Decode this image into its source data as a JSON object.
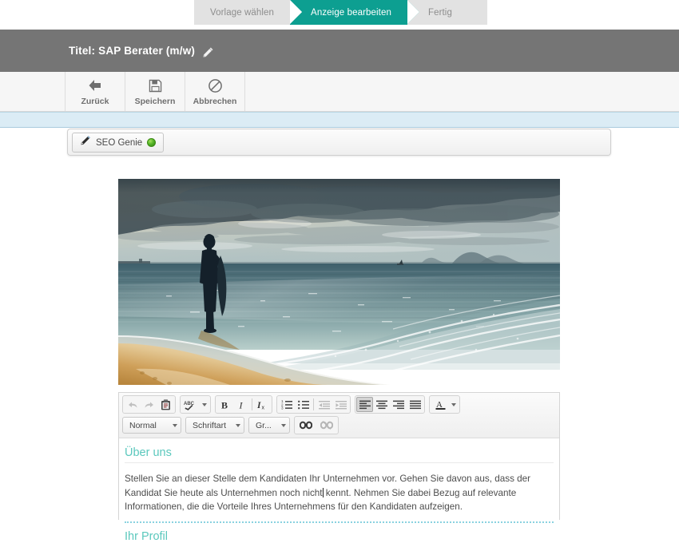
{
  "wizard": {
    "steps": [
      {
        "label": "Vorlage wählen",
        "active": false
      },
      {
        "label": "Anzeige bearbeiten",
        "active": true
      },
      {
        "label": "Fertig",
        "active": false
      }
    ],
    "active_color": "#0d9f91",
    "inactive_color": "#e2e2e2"
  },
  "titlebar": {
    "label": "Titel:",
    "value": "SAP Berater (m/w)",
    "full": "Titel: SAP Berater (m/w)",
    "edit_icon": "pencil-icon",
    "background": "#757575"
  },
  "actions": [
    {
      "label": "Zurück",
      "icon": "arrow-left-icon"
    },
    {
      "label": "Speichern",
      "icon": "floppy-disk-icon"
    },
    {
      "label": "Abbrechen",
      "icon": "prohibition-icon"
    }
  ],
  "seo": {
    "label": "SEO Genie",
    "icon": "magic-pen-icon",
    "status_icon": "green-status-dot",
    "status_color": "#56b528"
  },
  "hero": {
    "alt": "Silhouette einer Person am Strand bei Sonnenuntergang mit Wolken und Meer"
  },
  "editor": {
    "toolbar_row1": [
      {
        "name": "undo-icon",
        "title": "Rückgängig",
        "state": "disabled"
      },
      {
        "name": "redo-icon",
        "title": "Wiederholen",
        "state": "disabled"
      },
      {
        "name": "paste-clipboard-icon",
        "title": "Einfügen",
        "state": "normal"
      },
      {
        "name": "spellcheck-icon",
        "title": "Rechtschreibprüfung",
        "state": "dropdown"
      },
      {
        "name": "bold-icon",
        "title": "Fett",
        "label": "B",
        "state": "normal"
      },
      {
        "name": "italic-icon",
        "title": "Kursiv",
        "label": "I",
        "state": "normal"
      },
      {
        "name": "remove-format-icon",
        "title": "Formatierung entfernen",
        "label": "Ix",
        "state": "normal"
      },
      {
        "name": "numbered-list-icon",
        "title": "Nummerierte Liste",
        "state": "normal"
      },
      {
        "name": "bulleted-list-icon",
        "title": "Aufzählung",
        "state": "normal"
      },
      {
        "name": "outdent-icon",
        "title": "Einzug verkleinern",
        "state": "disabled"
      },
      {
        "name": "indent-icon",
        "title": "Einzug vergrößern",
        "state": "disabled"
      },
      {
        "name": "align-left-icon",
        "title": "Linksbündig",
        "state": "active"
      },
      {
        "name": "align-center-icon",
        "title": "Zentriert",
        "state": "normal"
      },
      {
        "name": "align-right-icon",
        "title": "Rechtsbündig",
        "state": "normal"
      },
      {
        "name": "align-justify-icon",
        "title": "Blocksatz",
        "state": "normal"
      },
      {
        "name": "text-color-icon",
        "title": "Textfarbe",
        "label": "A",
        "state": "dropdown"
      }
    ],
    "dropdowns": [
      {
        "name": "paragraph-format-select",
        "value": "Normal"
      },
      {
        "name": "font-family-select",
        "value": "Schriftart"
      },
      {
        "name": "font-size-select",
        "value": "Gr..."
      }
    ],
    "link_buttons": [
      {
        "name": "insert-link-icon",
        "title": "Link einfügen",
        "state": "normal"
      },
      {
        "name": "unlink-icon",
        "title": "Link entfernen",
        "state": "disabled"
      }
    ],
    "content": {
      "heading": "Über uns",
      "paragraph_part1": "Stellen Sie an dieser Stelle dem Kandidaten Ihr Unternehmen vor. Gehen Sie davon aus, dass der Kandidat Sie heute als Unternehmen noch nicht",
      "paragraph_part2": " kennt. Nehmen Sie dabei Bezug auf relevante Informationen, die die Vorteile Ihres Unternehmens für den Kandidaten aufzeigen.",
      "paragraph_full": "Stellen Sie an dieser Stelle dem Kandidaten Ihr Unternehmen vor. Gehen Sie davon aus, dass der Kandidat Sie heute als Unternehmen noch nicht kennt. Nehmen Sie dabei Bezug auf relevante Informationen, die die Vorteile Ihres Unternehmens für den Kandidaten aufzeigen.",
      "heading2": "Ihr Profil",
      "heading_color": "#5bc8bd"
    }
  },
  "colors": {
    "accent_teal": "#0d9f91",
    "heading_teal": "#5bc8bd",
    "titlebar_grey": "#757575",
    "band_blue": "#dbecf5"
  }
}
